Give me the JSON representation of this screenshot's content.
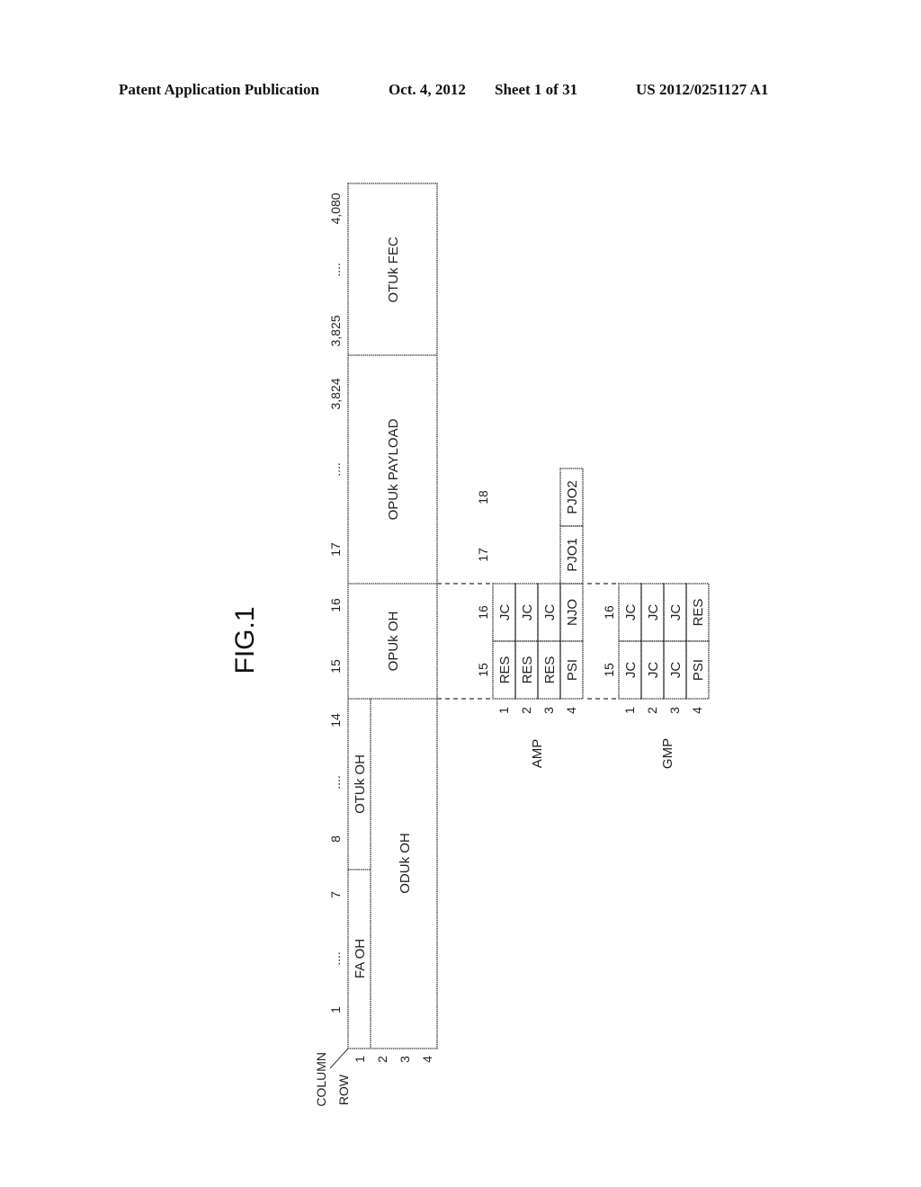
{
  "header": {
    "left": "Patent Application Publication",
    "date": "Oct. 4, 2012",
    "sheet": "Sheet 1 of 31",
    "number": "US 2012/0251127 A1"
  },
  "figure": {
    "title": "FIG.1",
    "axis": {
      "column": "COLUMN",
      "row": "ROW"
    },
    "column_labels": [
      "1",
      "....",
      "7",
      "8",
      "....",
      "14",
      "15",
      "16",
      "17",
      "....",
      "3,824",
      "3,825",
      "....",
      "4,080"
    ],
    "row_labels": [
      "1",
      "2",
      "3",
      "4"
    ],
    "frame_blocks": {
      "fa_oh": "FA OH",
      "otuk_oh": "OTUk OH",
      "oduk_oh": "ODUk OH",
      "opuk_oh": "OPUk OH",
      "opuk_payload": "OPUk PAYLOAD",
      "otuk_fec": "OTUk FEC"
    },
    "amp": {
      "label": "AMP",
      "columns": [
        "15",
        "16",
        "17",
        "18"
      ],
      "rows": [
        "1",
        "2",
        "3",
        "4"
      ],
      "cells": [
        [
          "RES",
          "JC"
        ],
        [
          "RES",
          "JC"
        ],
        [
          "RES",
          "JC"
        ],
        [
          "PSI",
          "NJO",
          "PJO1",
          "PJO2"
        ]
      ]
    },
    "gmp": {
      "label": "GMP",
      "columns": [
        "15",
        "16"
      ],
      "rows": [
        "1",
        "2",
        "3",
        "4"
      ],
      "cells": [
        [
          "JC",
          "JC"
        ],
        [
          "JC",
          "JC"
        ],
        [
          "JC",
          "JC"
        ],
        [
          "PSI",
          "RES"
        ]
      ]
    }
  }
}
